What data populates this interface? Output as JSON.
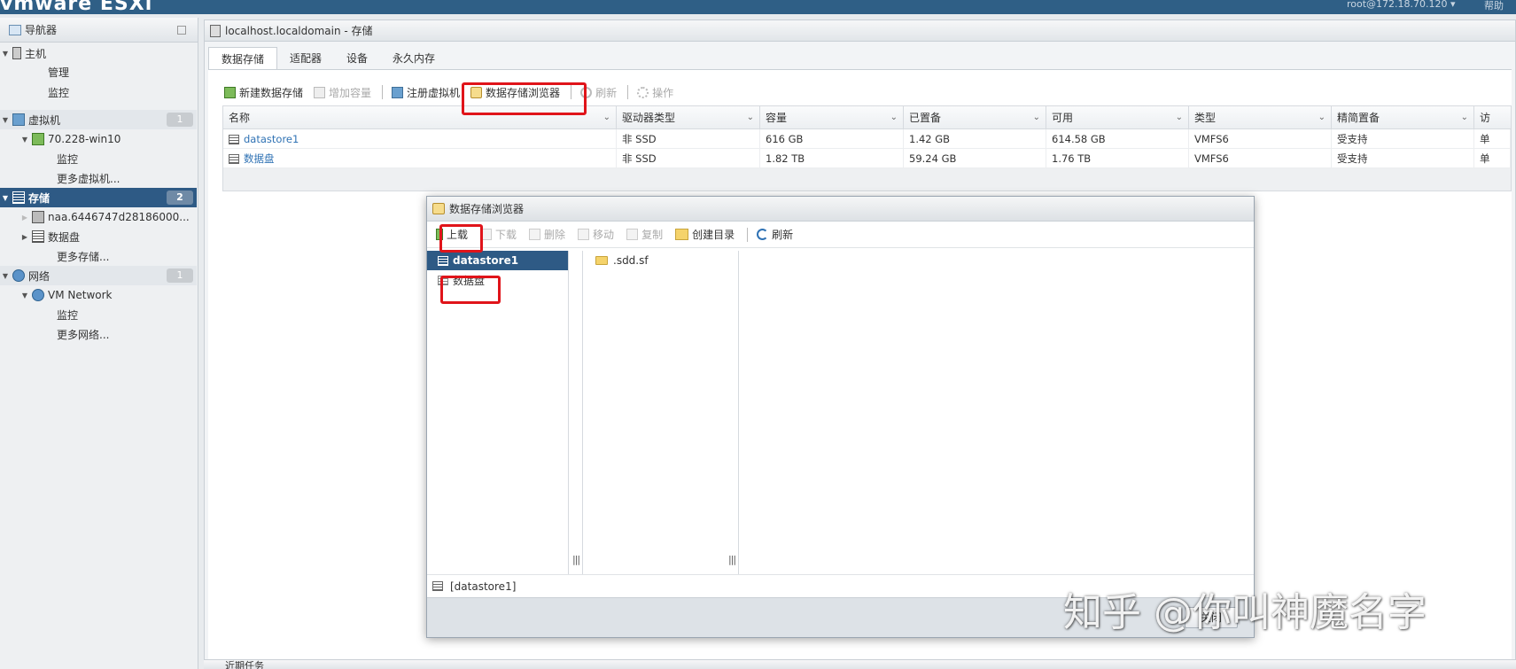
{
  "topbar": {
    "brand": "vmware ESXi",
    "user": "root@172.18.70.120 ▾",
    "help": "帮助"
  },
  "navigator": {
    "title": "导航器",
    "items": [
      {
        "label": "主机"
      },
      {
        "label": "管理"
      },
      {
        "label": "监控"
      },
      {
        "label": "虚拟机",
        "badge": "1"
      },
      {
        "label": "70.228-win10"
      },
      {
        "label": "监控"
      },
      {
        "label": "更多虚拟机..."
      },
      {
        "label": "存储",
        "badge": "2"
      },
      {
        "label": "naa.6446747d28186000..."
      },
      {
        "label": "数据盘"
      },
      {
        "label": "更多存储..."
      },
      {
        "label": "网络",
        "badge": "1"
      },
      {
        "label": "VM Network"
      },
      {
        "label": "监控"
      },
      {
        "label": "更多网络..."
      }
    ]
  },
  "main": {
    "title": "localhost.localdomain - 存储",
    "tabs": [
      "数据存储",
      "适配器",
      "设备",
      "永久内存"
    ],
    "toolbar": {
      "new_datastore": "新建数据存储",
      "increase_capacity": "增加容量",
      "register_vm": "注册虚拟机",
      "datastore_browser": "数据存储浏览器",
      "refresh": "刷新",
      "actions": "操作"
    },
    "table": {
      "columns": [
        "名称",
        "驱动器类型",
        "容量",
        "已置备",
        "可用",
        "类型",
        "精简置备",
        "访"
      ],
      "rows": [
        [
          "datastore1",
          "非 SSD",
          "616 GB",
          "1.42 GB",
          "614.58 GB",
          "VMFS6",
          "受支持",
          "单"
        ],
        [
          "数据盘",
          "非 SSD",
          "1.82 TB",
          "59.24 GB",
          "1.76 TB",
          "VMFS6",
          "受支持",
          "单"
        ]
      ]
    },
    "bottom_tab": "近期任务"
  },
  "dialog": {
    "title": "数据存储浏览器",
    "toolbar": {
      "upload": "上载",
      "download": "下载",
      "delete": "删除",
      "move": "移动",
      "copy": "复制",
      "mkdir": "创建目录",
      "refresh": "刷新"
    },
    "datastores": [
      "datastore1",
      "数据盘"
    ],
    "files": [
      ".sdd.sf"
    ],
    "path": "[datastore1]",
    "close": "关闭"
  },
  "watermark": "知乎 @你叫神魔名字"
}
